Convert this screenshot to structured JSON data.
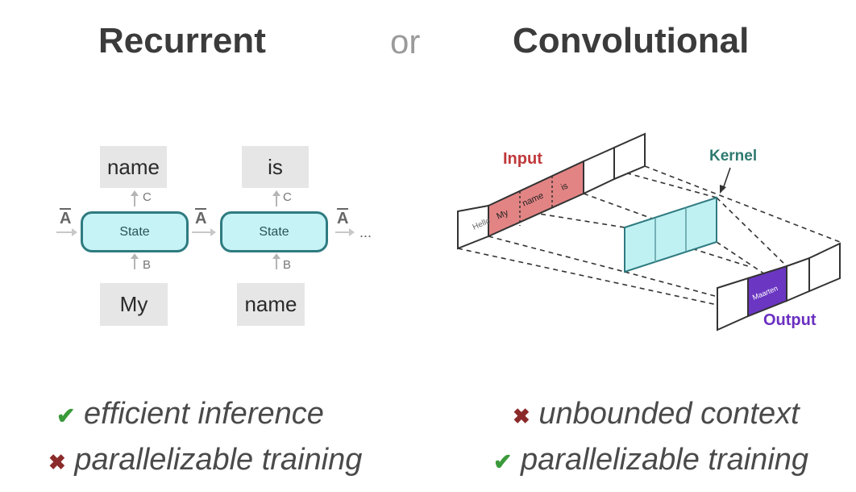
{
  "headings": {
    "left": "Recurrent",
    "or": "or",
    "right": "Convolutional"
  },
  "recurrent": {
    "outputs": [
      "name",
      "is"
    ],
    "inputs": [
      "My",
      "name"
    ],
    "state_label": "State",
    "a_label": "A",
    "b_label": "B",
    "c_label": "C",
    "ellipsis": "..."
  },
  "convolutional": {
    "input_label": "Input",
    "kernel_label": "Kernel",
    "output_label": "Output",
    "input_tokens": [
      "Hello",
      "My",
      "name",
      "is"
    ],
    "output_token": "Maarten",
    "colors": {
      "input": "#e38484",
      "kernel": "#bff1f3",
      "output": "#6b36c2",
      "input_text": "#c0393b",
      "kernel_text": "#2f7a70",
      "output_text": "#6a2fc0"
    }
  },
  "bullets": {
    "left": [
      {
        "mark": "✔",
        "kind": "check",
        "text": "efficient inference"
      },
      {
        "mark": "✖",
        "kind": "cross",
        "text": "parallelizable training"
      }
    ],
    "right": [
      {
        "mark": "✖",
        "kind": "cross",
        "text": "unbounded context"
      },
      {
        "mark": "✔",
        "kind": "check",
        "text": "parallelizable training"
      }
    ]
  }
}
